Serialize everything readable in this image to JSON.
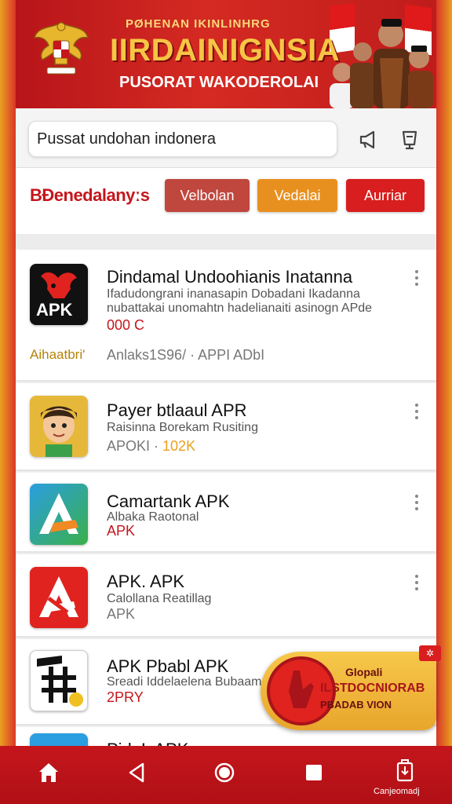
{
  "banner": {
    "top_text": "PØHENAN IKINLINHRG",
    "title": "IIRDAINIGNSIA",
    "subtitle": "PUSORAT WAKODEROLAI"
  },
  "search": {
    "value": "Pussat undohan indonera",
    "placeholder": "Pussat undohan indonera"
  },
  "filter": {
    "label": "BÐenedalanyːs",
    "chips": [
      "Velbolan",
      "Vedalai",
      "Aurriar"
    ]
  },
  "apps": [
    {
      "title": "Dindamal Undoohianis Inatanna",
      "lines": [
        "Ifadudongrani  inanasapin Dobadani  Ikadanna",
        "nubattakai unomahtn hadelianaiti asinogn APde"
      ],
      "price": "000 C",
      "tag": "Aihaatbri'",
      "meta": "Anlaks1S96/ · APPI ADbI",
      "icon_label": "APK"
    },
    {
      "title": "Payer btlaaul APR",
      "line": "Raisinna Borekam Rusiting",
      "meta_prefix": "APOKI ·",
      "meta_value": "102K"
    },
    {
      "title": "Camartank APK",
      "line": "Albaka Raotonal",
      "meta": "APK"
    },
    {
      "title": "APK. APK",
      "line": "Calollana Reatillag",
      "meta": "APK"
    },
    {
      "title": "APK Pbabl APK",
      "line": "Sreadi Iddelaelena Bubaam",
      "meta": "2PRY"
    },
    {
      "title": "PidaL APK"
    }
  ],
  "promo": {
    "line1": "Glopali",
    "line2": "ILSTDOCNIORAB",
    "line3": "PBADAB VION"
  },
  "nav": {
    "label": "Canjeomadj"
  },
  "colors": {
    "brand_red": "#c4161c",
    "chip_1": "#c0473e",
    "chip_2": "#e8901f",
    "chip_3": "#d81e1e",
    "gold": "#f6c545"
  }
}
